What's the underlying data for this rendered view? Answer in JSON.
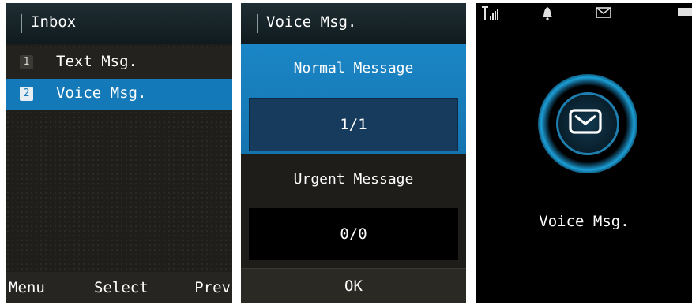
{
  "screen1": {
    "title": "Inbox",
    "items": [
      {
        "num": "1",
        "label": "Text Msg."
      },
      {
        "num": "2",
        "label": "Voice Msg."
      }
    ],
    "softkeys": {
      "left": "Menu",
      "center": "Select",
      "right": "Prev"
    }
  },
  "screen2": {
    "title": "Voice Msg.",
    "normal_label": "Normal Message",
    "normal_count": "1/1",
    "urgent_label": "Urgent Message",
    "urgent_count": "0/0",
    "ok_label": "OK"
  },
  "screen3": {
    "status_icons": [
      "signal-icon",
      "bell-icon",
      "envelope-icon",
      "battery-icon"
    ],
    "caption": "Voice Msg."
  },
  "colors": {
    "highlight": "#1479b8",
    "normal_box": "#173b5c",
    "ring": "#1b9fd6"
  }
}
